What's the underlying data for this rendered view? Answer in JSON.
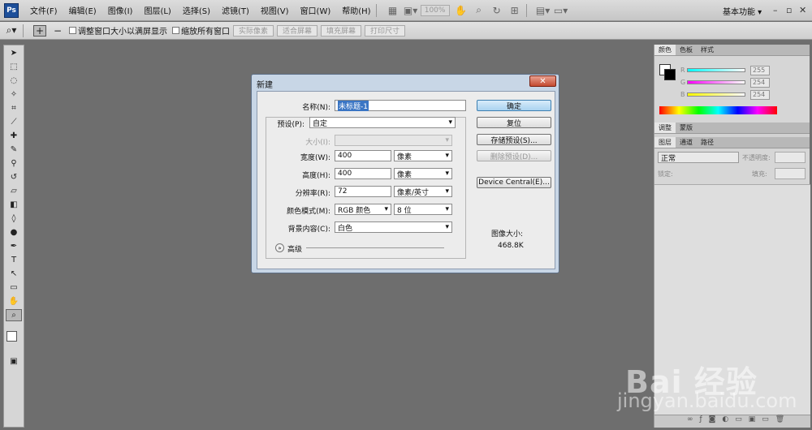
{
  "app": {
    "logo": "Ps"
  },
  "menu": [
    "文件(F)",
    "编辑(E)",
    "图像(I)",
    "图层(L)",
    "选择(S)",
    "滤镜(T)",
    "视图(V)",
    "窗口(W)",
    "帮助(H)"
  ],
  "menubar": {
    "zoom": "100%",
    "workspace": "基本功能 ▾"
  },
  "options": {
    "resize_windows": "调整窗口大小以满屏显示",
    "zoom_all": "缩放所有窗口",
    "buttons": [
      "实际像素",
      "适合屏幕",
      "填充屏幕",
      "打印尺寸"
    ]
  },
  "panels": {
    "tabs_top": [
      "颜色",
      "色板",
      "样式"
    ],
    "color_values": [
      "255",
      "254",
      "254"
    ],
    "color_letters": [
      "R",
      "G",
      "B"
    ],
    "tabs_mid": [
      "调整",
      "蒙版"
    ],
    "tabs_layers": [
      "图层",
      "通道",
      "路径"
    ],
    "blend_mode": "正常",
    "opacity_label": "不透明度:",
    "lock_label": "锁定:",
    "fill_label": "填充:"
  },
  "dialog": {
    "title": "新建",
    "name_label": "名称(N):",
    "name_value": "未标题-1",
    "preset_label": "预设(P):",
    "preset_value": "自定",
    "size_label": "大小(I):",
    "width_label": "宽度(W):",
    "width_value": "400",
    "width_unit": "像素",
    "height_label": "高度(H):",
    "height_value": "400",
    "height_unit": "像素",
    "resolution_label": "分辨率(R):",
    "resolution_value": "72",
    "resolution_unit": "像素/英寸",
    "color_mode_label": "颜色模式(M):",
    "color_mode_value": "RGB 颜色",
    "bit_depth": "8 位",
    "background_label": "背景内容(C):",
    "background_value": "白色",
    "advanced_label": "高级",
    "ok": "确定",
    "reset": "复位",
    "save_preset": "存储预设(S)...",
    "delete_preset": "删除预设(D)...",
    "device_central": "Device Central(E)...",
    "image_size_label": "图像大小:",
    "image_size_value": "468.8K"
  },
  "watermark": {
    "logo": "Bai 经验",
    "url": "jingyan.baidu.com"
  },
  "colors": {
    "dialog_frame": "#c8d6e6",
    "close_button": "#c44a30",
    "workspace_bg": "#6e6e6e"
  }
}
